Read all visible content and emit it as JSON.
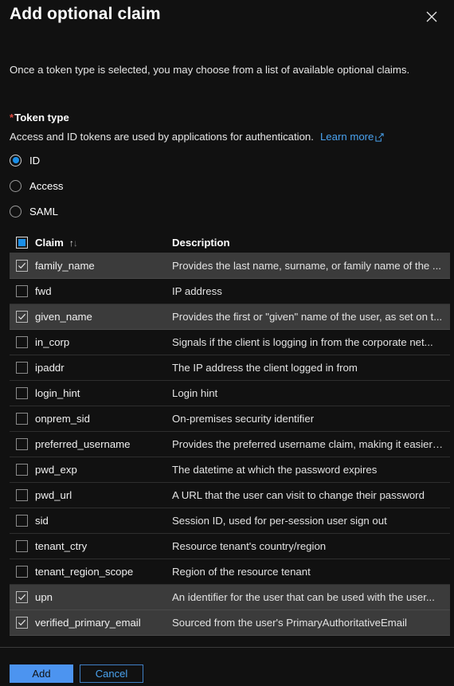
{
  "dialog": {
    "title": "Add optional claim",
    "close_icon": "close-icon",
    "intro": "Once a token type is selected, you may choose from a list of available optional claims."
  },
  "token_type": {
    "required_marker": "*",
    "label": "Token type",
    "description": "Access and ID tokens are used by applications for authentication.",
    "learn_more_label": "Learn more",
    "external_link_icon": "external-link-icon",
    "selected": "ID",
    "options": [
      {
        "label": "ID",
        "checked": true
      },
      {
        "label": "Access",
        "checked": false
      },
      {
        "label": "SAML",
        "checked": false
      }
    ]
  },
  "table": {
    "select_all_state": "indeterminate",
    "columns": {
      "claim": "Claim",
      "description": "Description"
    },
    "sort_icon": "sort-ascending-icon",
    "sort_up_glyph": "↑",
    "sort_down_glyph": "↓",
    "rows": [
      {
        "claim": "family_name",
        "description": "Provides the last name, surname, or family name of the ...",
        "selected": true
      },
      {
        "claim": "fwd",
        "description": "IP address",
        "selected": false
      },
      {
        "claim": "given_name",
        "description": "Provides the first or \"given\" name of the user, as set on t...",
        "selected": true
      },
      {
        "claim": "in_corp",
        "description": "Signals if the client is logging in from the corporate net...",
        "selected": false
      },
      {
        "claim": "ipaddr",
        "description": "The IP address the client logged in from",
        "selected": false
      },
      {
        "claim": "login_hint",
        "description": "Login hint",
        "selected": false
      },
      {
        "claim": "onprem_sid",
        "description": "On-premises security identifier",
        "selected": false
      },
      {
        "claim": "preferred_username",
        "description": "Provides the preferred username claim, making it easier ...",
        "selected": false
      },
      {
        "claim": "pwd_exp",
        "description": "The datetime at which the password expires",
        "selected": false
      },
      {
        "claim": "pwd_url",
        "description": "A URL that the user can visit to change their password",
        "selected": false
      },
      {
        "claim": "sid",
        "description": "Session ID, used for per-session user sign out",
        "selected": false
      },
      {
        "claim": "tenant_ctry",
        "description": "Resource tenant's country/region",
        "selected": false
      },
      {
        "claim": "tenant_region_scope",
        "description": "Region of the resource tenant",
        "selected": false
      },
      {
        "claim": "upn",
        "description": "An identifier for the user that can be used with the user...",
        "selected": true
      },
      {
        "claim": "verified_primary_email",
        "description": "Sourced from the user's PrimaryAuthoritativeEmail",
        "selected": true
      }
    ]
  },
  "footer": {
    "add_label": "Add",
    "cancel_label": "Cancel"
  },
  "colors": {
    "accent_blue": "#1a8fe8",
    "link_blue": "#4aa3f0",
    "primary_button": "#4c94f0",
    "required_red": "#e24a41",
    "selected_row": "#3b3b3b",
    "background": "#111111"
  }
}
